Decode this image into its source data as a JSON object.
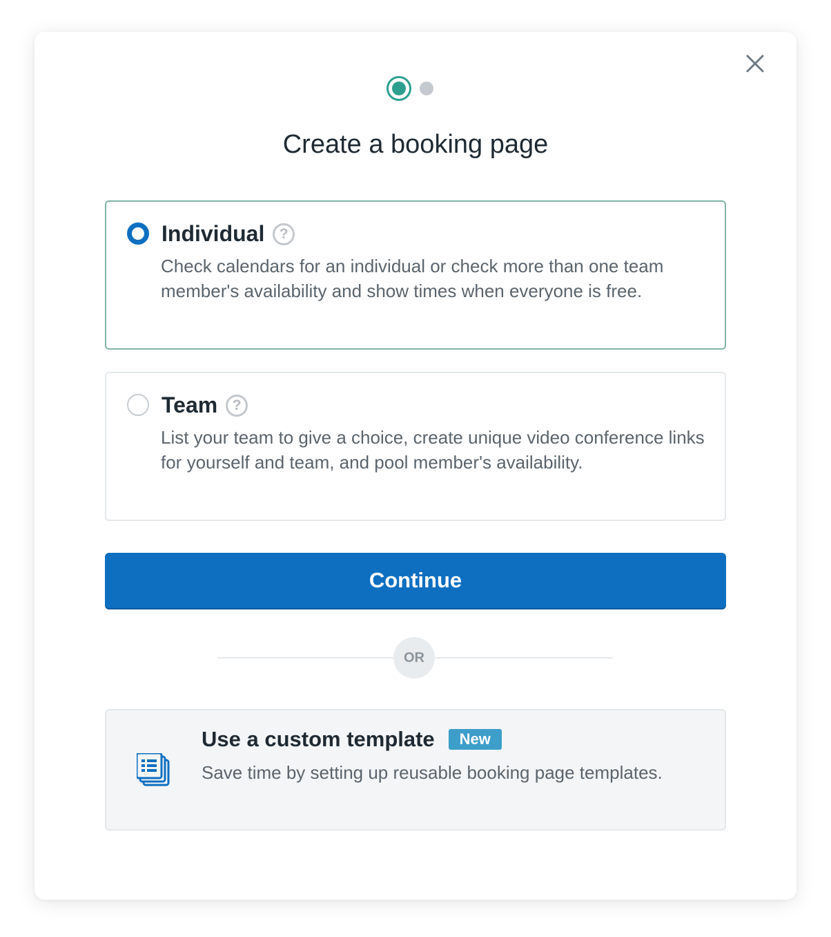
{
  "modal": {
    "title": "Create a booking page",
    "steps": {
      "current": 1,
      "total": 2
    }
  },
  "options": [
    {
      "label": "Individual",
      "description": "Check calendars for an individual or check more than one team member's availability and show times when everyone is free.",
      "selected": true
    },
    {
      "label": "Team",
      "description": "List your team to give a choice, create unique video conference links for yourself and team, and pool member's availability.",
      "selected": false
    }
  ],
  "help_glyph": "?",
  "continue_label": "Continue",
  "divider_label": "OR",
  "template": {
    "title": "Use a custom template",
    "badge": "New",
    "description": "Save time by setting up reusable booking page templates."
  },
  "icons": {
    "close": "close-icon",
    "help": "help-circle-icon",
    "template": "template-stack-icon"
  },
  "colors": {
    "primary": "#0e6fc0",
    "step_active": "#2c9f8f",
    "step_inactive": "#c4cad0",
    "selected_border": "#7fb3a6",
    "badge": "#3d9ec9"
  }
}
